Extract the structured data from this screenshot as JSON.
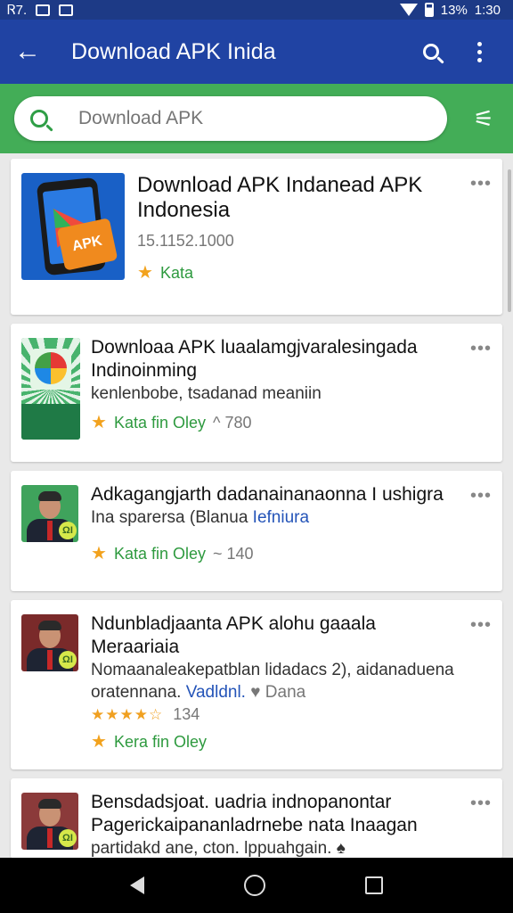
{
  "status_bar": {
    "left_text": "Ꮢ7.",
    "battery_text": "13%",
    "time": "1:30"
  },
  "app_bar": {
    "back_icon": "arrow-back-icon",
    "title": "Download APK Inida",
    "search_icon": "search-icon",
    "overflow_icon": "more-vert-icon"
  },
  "search": {
    "placeholder": "Download APK",
    "value": "",
    "tool_icon": "magic-wand-icon",
    "tool_glyph": "⚟"
  },
  "results": [
    {
      "title": "Download APK Indanead APK Indonesia",
      "meta": "15.1152.1000",
      "rating_label": "Kata",
      "count": ""
    },
    {
      "title": "Downloaa APK luaalamgjvaralesingada",
      "title2": "Indinoinming",
      "subtitle": "kenlenbobe, tsadanad meaniin",
      "rating_label": "Kata ﬁn Oley",
      "count": "^ 780"
    },
    {
      "title": "Adkagangjarth dadanainanaonna I ushigra",
      "subtitle": "Ina sparersa (Blanua ",
      "subtitle_link": "Iefniura",
      "rating_label": "Kata ﬁn Oley",
      "count": "~ 140"
    },
    {
      "title": "Ndunbladjaanta APK alohu gaaala",
      "title2": "Meraariaia",
      "subtitle": "Nomaanaleakepatblan lidadacs 2), aidanaduena",
      "subtitle2_a": "oratennana. ",
      "subtitle2_link": "Vadldnl.",
      "subtitle2_b": " ♥ Dana",
      "stars": "★★★★☆",
      "stars_count": "134",
      "rating_label": "Kera ﬁn Oley"
    },
    {
      "title": "Bensdadsjoat. uadria indnopanontar",
      "title2": "Pagerickaipananladrnebe nata Inaagan",
      "subtitle": "partidakd ane, cton.  lppuahgain. ♠"
    }
  ],
  "icons": {
    "nav_back": "nav-back-icon",
    "nav_home": "nav-home-icon",
    "nav_recent": "nav-recent-icon"
  },
  "colors": {
    "app_bar": "#2043a3",
    "search_band": "#43ad57",
    "accent_green": "#2e9a3f",
    "star": "#f2a21d"
  }
}
